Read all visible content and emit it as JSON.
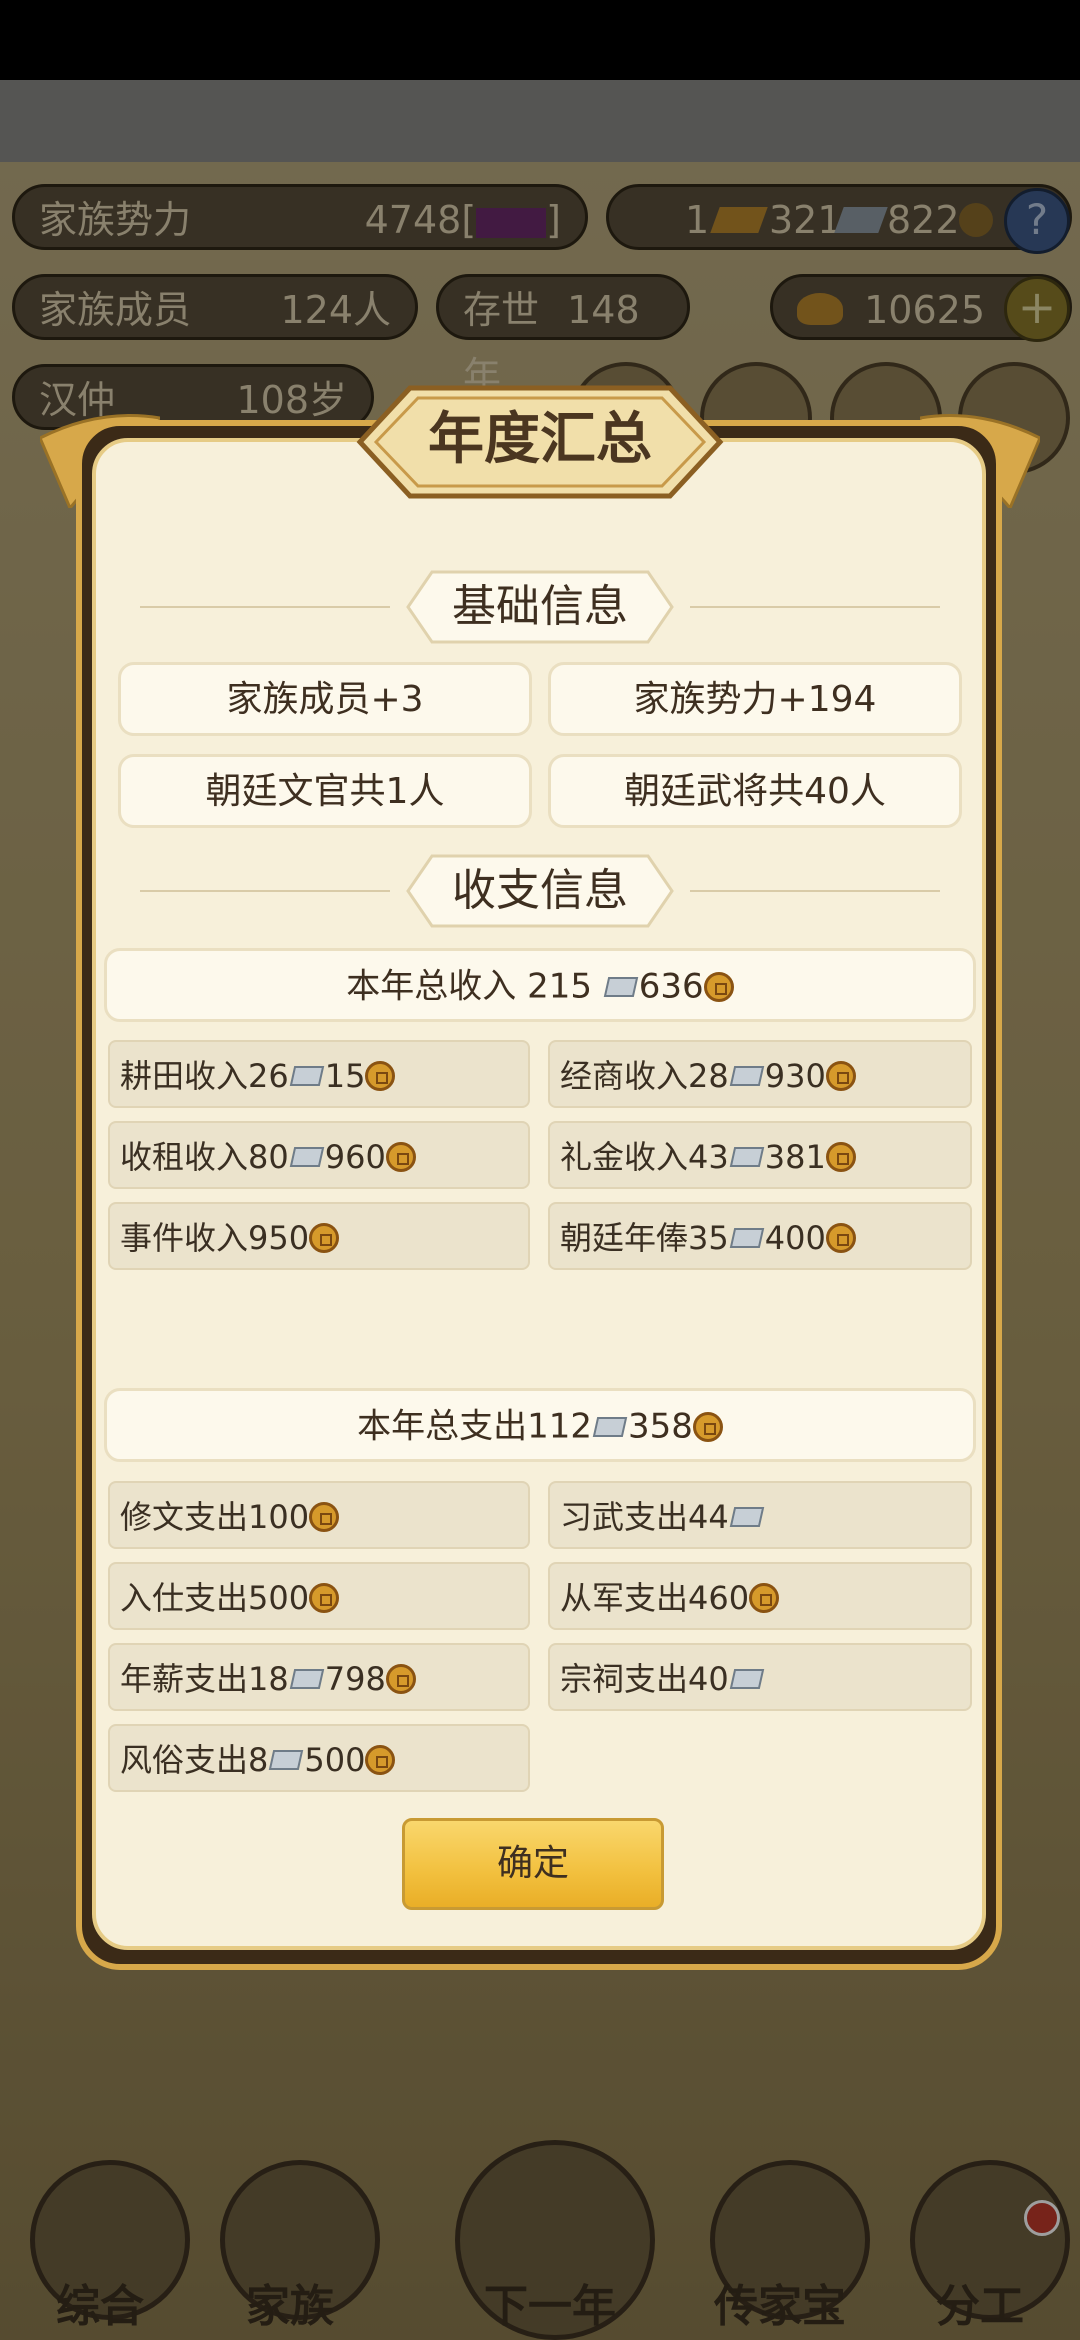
{
  "background": {
    "top_row": {
      "clan_power_label": "家族势力",
      "clan_power_value": "4748[",
      "clan_power_bracket_close": "]",
      "gold_amount": "1",
      "silver_amount": "321",
      "coin_amount": "822",
      "help_symbol": "?"
    },
    "second_row": {
      "members_label": "家族成员",
      "members_value": "124人",
      "existence_label": "存世",
      "existence_value": "148年",
      "ingot_amount": "10625",
      "add_symbol": "+"
    },
    "third_row": {
      "leader_name": "汉仲",
      "leader_age": "108岁"
    },
    "nav": [
      {
        "label": "综合"
      },
      {
        "label": "家族"
      },
      {
        "label": "下一年"
      },
      {
        "label": "传家宝"
      },
      {
        "label": "分工"
      }
    ]
  },
  "dialog": {
    "title": "年度汇总",
    "basic_section_title": "基础信息",
    "basic_items": [
      "家族成员+3",
      "家族势力+194",
      "朝廷文官共1人",
      "朝廷武将共40人"
    ],
    "finance_section_title": "收支信息",
    "income_total": {
      "prefix": "本年总收入 215",
      "coins": "636"
    },
    "income_items": [
      {
        "label": "耕田收入26",
        "silver": true,
        "coins": "15"
      },
      {
        "label": "经商收入28",
        "silver": true,
        "coins": "930"
      },
      {
        "label": "收租收入80",
        "silver": true,
        "coins": "960"
      },
      {
        "label": "礼金收入43",
        "silver": true,
        "coins": "381"
      },
      {
        "label": "事件收入950",
        "silver": false,
        "coins": ""
      },
      {
        "label": "朝廷年俸35",
        "silver": true,
        "coins": "400"
      }
    ],
    "expense_total": {
      "prefix": "本年总支出112",
      "coins": "358"
    },
    "expense_items": [
      {
        "label": "修文支出100",
        "kind": "coin"
      },
      {
        "label": "习武支出44",
        "kind": "silver"
      },
      {
        "label": "入仕支出500",
        "kind": "coin"
      },
      {
        "label": "从军支出460",
        "kind": "coin"
      },
      {
        "label": "年薪支出18",
        "kind": "both",
        "coins": "798"
      },
      {
        "label": "宗祠支出40",
        "kind": "silver"
      },
      {
        "label": "风俗支出8",
        "kind": "both",
        "coins": "500"
      }
    ],
    "confirm_label": "确定"
  },
  "colors": {
    "dialog_bg": "#f7f0da",
    "frame_gold": "#d7a84a",
    "button_gold": "#f2c03e",
    "coin": "#d69a2b",
    "text_dark": "#3e2f20"
  }
}
